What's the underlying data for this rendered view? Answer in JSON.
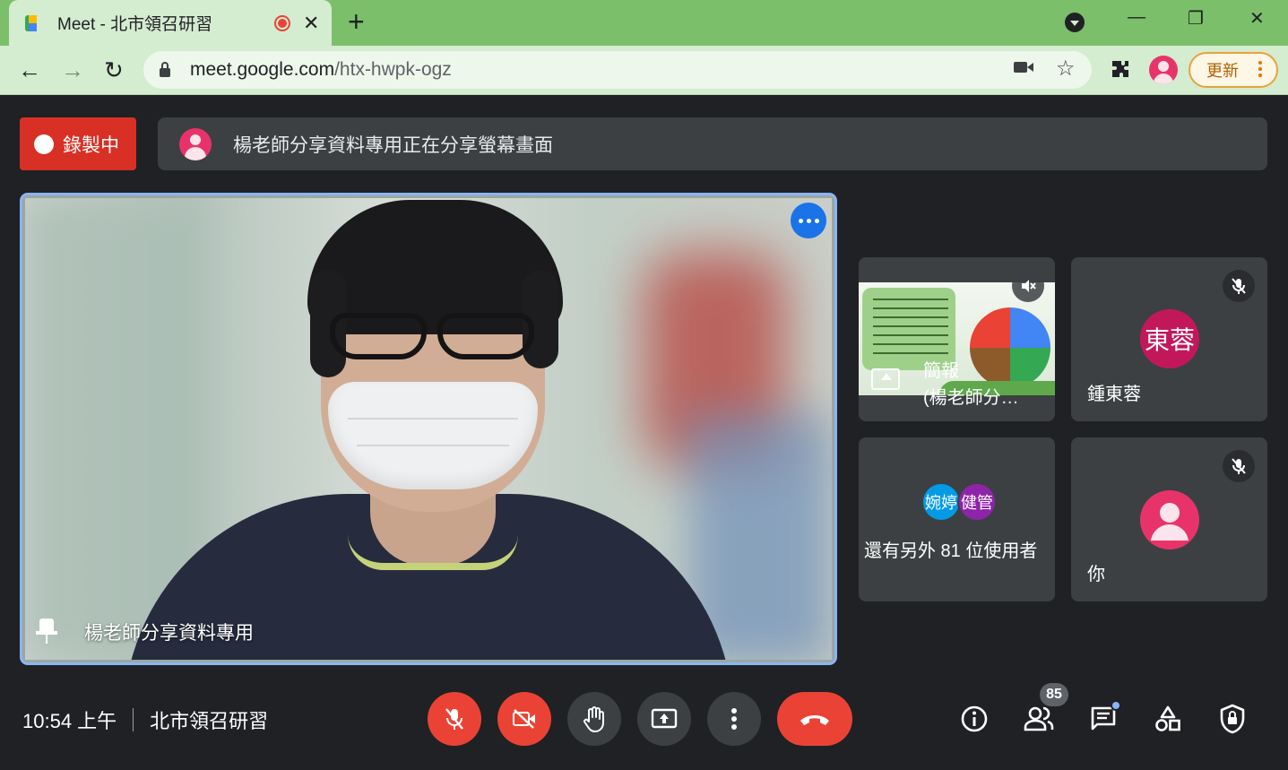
{
  "browser": {
    "tab_title": "Meet - 北市領召研習",
    "new_tab": "+",
    "url_host": "meet.google.com",
    "url_path": "/htx-hwpk-ogz",
    "update_label": "更新"
  },
  "meeting": {
    "recording_label": "錄製中",
    "share_banner": "楊老師分享資料專用正在分享螢幕畫面",
    "main_participant": "楊老師分享資料專用",
    "clock": "10:54 上午",
    "meeting_name": "北市領召研習",
    "participant_count": "85"
  },
  "tiles": [
    {
      "name": "簡報\n(楊老師分…",
      "label_line1": "簡報",
      "label_line2": "(楊老師分…"
    },
    {
      "initials": "東蓉",
      "name": "鍾東蓉",
      "avatar_color": "#c2185b"
    },
    {
      "avatar1": "婉婷",
      "avatar1_color": "#039be5",
      "avatar2": "健管",
      "avatar2_color": "#8e24aa",
      "label": "還有另外 81 位使用者"
    },
    {
      "name": "你",
      "avatar_color": "#e8336a"
    }
  ]
}
